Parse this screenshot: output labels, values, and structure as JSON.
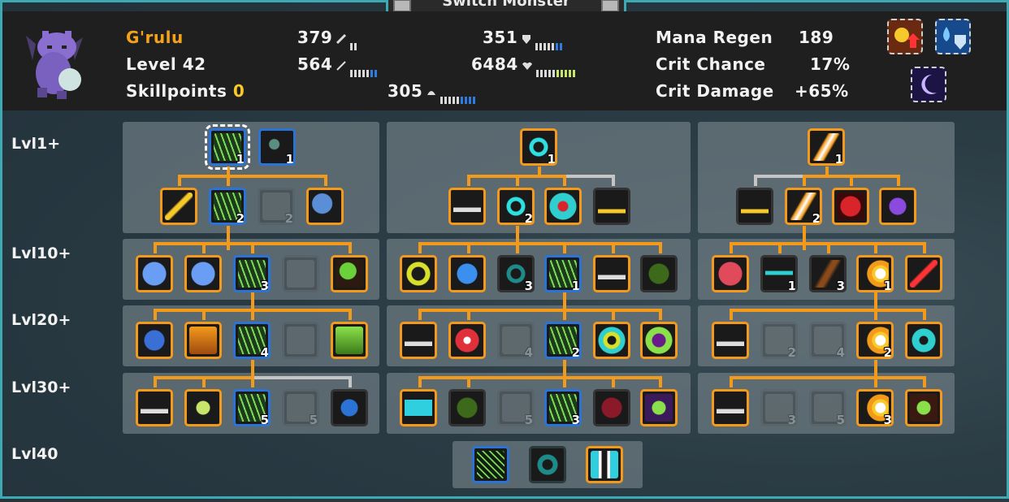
{
  "window": {
    "title": "Switch Monster"
  },
  "monster": {
    "name": "G'rulu",
    "level_label": "Level 42",
    "skillpoints_label": "Skillpoints",
    "skillpoints_value": "0"
  },
  "stats": {
    "attack": "379",
    "armor": "351",
    "magic_power": "564",
    "health": "6484",
    "defense": "305",
    "mana_regen_label": "Mana Regen",
    "mana_regen_value": "189",
    "crit_chance_label": "Crit Chance",
    "crit_chance_value": "17%",
    "crit_damage_label": "Crit Damage",
    "crit_damage_value": "+65%"
  },
  "tiers": [
    "Lvl1+",
    "Lvl10+",
    "Lvl20+",
    "Lvl30+",
    "Lvl40"
  ],
  "colors": {
    "accent": "#f39a1a",
    "frame": "#3fa9b3",
    "selected": "#2b74d6",
    "name": "#f3a21b",
    "skillpoints": "#f7c92a"
  },
  "skill_levels": {
    "t1_a": "1",
    "t1_b": "1",
    "t1_c": "2",
    "t1_d": "2",
    "t2_a": "3",
    "t3_a": "4",
    "t4_a": "5",
    "t4_b": "5",
    "m1": "1",
    "m1b": "2",
    "m2a": "3",
    "m2b": "1",
    "m3a": "4",
    "m3b": "2",
    "m4a": "5",
    "m4b": "3",
    "r1": "1",
    "r1b": "2",
    "r2a": "1",
    "r2b": "3",
    "r2c": "1",
    "r3a": "2",
    "r3b": "4",
    "r3c": "2",
    "r4a": "3",
    "r4b": "5",
    "r4c": "3"
  }
}
